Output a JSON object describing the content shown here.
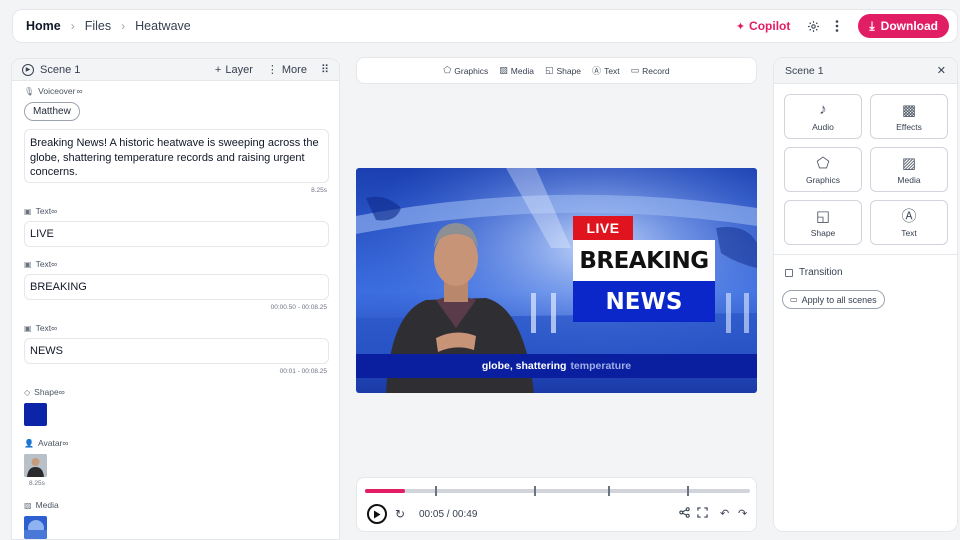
{
  "breadcrumb": [
    "Home",
    "Files",
    "Heatwave"
  ],
  "header": {
    "copilot_label": "Copilot",
    "download_label": "Download"
  },
  "colors": {
    "accent": "#e11d63",
    "live_red": "#e0141e",
    "news_blue": "#0b27c9",
    "shape_fill": "#0b24a8"
  },
  "left_panel": {
    "scene_label": "Scene 1",
    "layer_label": "Layer",
    "more_label": "More",
    "voiceover": {
      "label": "Voiceover",
      "voice": "Matthew",
      "script": "Breaking News! A historic heatwave is sweeping across the globe, shattering temperature records and raising urgent concerns.",
      "duration": "8.25s"
    },
    "text_layers": [
      {
        "label": "Text",
        "value": "LIVE",
        "timing": ""
      },
      {
        "label": "Text",
        "value": "BREAKING",
        "timing": "00:00.50 - 00:08.25"
      },
      {
        "label": "Text",
        "value": "NEWS",
        "timing": "00:01 - 00:08.25"
      }
    ],
    "shape": {
      "label": "Shape"
    },
    "avatar": {
      "label": "Avatar",
      "duration": "8.25s"
    },
    "media": {
      "label": "Media"
    }
  },
  "center_toolbar": [
    "Graphics",
    "Media",
    "Shape",
    "Text",
    "Record"
  ],
  "video": {
    "live_text": "LIVE",
    "breaking_text": "BREAKING",
    "news_text": "NEWS",
    "caption_bold": "globe, shattering",
    "caption_dim": "temperature"
  },
  "player": {
    "current": "00:05",
    "total": "00:49",
    "time_display": "00:05 / 00:49",
    "progress": 0.104
  },
  "right_panel": {
    "title": "Scene 1",
    "tiles": [
      {
        "label": "Audio",
        "icon": "music-note-icon"
      },
      {
        "label": "Effects",
        "icon": "effects-icon"
      },
      {
        "label": "Graphics",
        "icon": "graphics-icon"
      },
      {
        "label": "Media",
        "icon": "image-icon"
      },
      {
        "label": "Shape",
        "icon": "shape-icon"
      },
      {
        "label": "Text",
        "icon": "text-icon"
      }
    ],
    "transition_label": "Transition",
    "apply_label": "Apply to all scenes"
  }
}
